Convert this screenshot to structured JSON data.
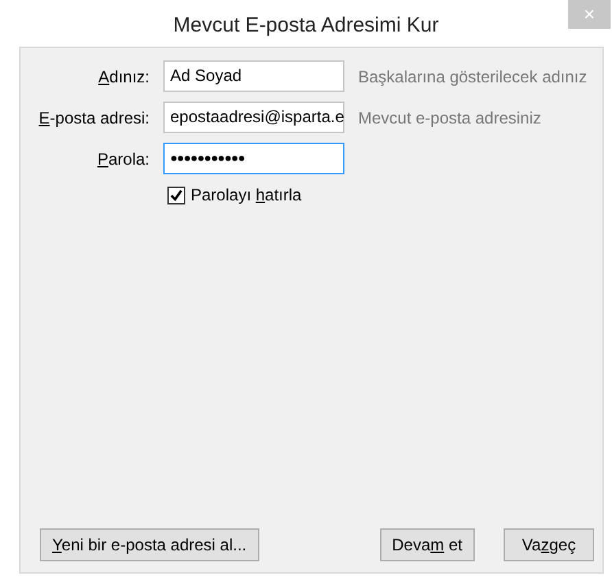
{
  "window": {
    "title": "Mevcut E-posta Adresimi Kur",
    "close": "×"
  },
  "fields": [
    {
      "label": {
        "key": "A",
        "after": "dınız:"
      },
      "value": "Ad Soyad",
      "hint": "Başkalarına gösterilecek adınız",
      "focused": false,
      "kind": "text"
    },
    {
      "label": {
        "key": "E",
        "after": "-posta adresi:"
      },
      "value": "epostaadresi@isparta.e",
      "hint": "Mevcut e-posta adresiniz",
      "focused": false,
      "kind": "text"
    },
    {
      "label": {
        "key": "P",
        "after": "arola:"
      },
      "value": "●●●●●●●●●●●",
      "focused": true,
      "kind": "password"
    }
  ],
  "remember": {
    "label": {
      "before": "Parolayı ",
      "key": "h",
      "after": "atırla"
    },
    "checked": true
  },
  "left_buttons": [
    {
      "label": {
        "key": "Y",
        "after": "eni bir e-posta adresi al..."
      }
    }
  ],
  "right_buttons": [
    {
      "label": {
        "before": "Deva",
        "key": "m",
        "after": " et"
      }
    },
    {
      "label": {
        "before": "Va",
        "key": "z",
        "after": "geç"
      }
    }
  ]
}
